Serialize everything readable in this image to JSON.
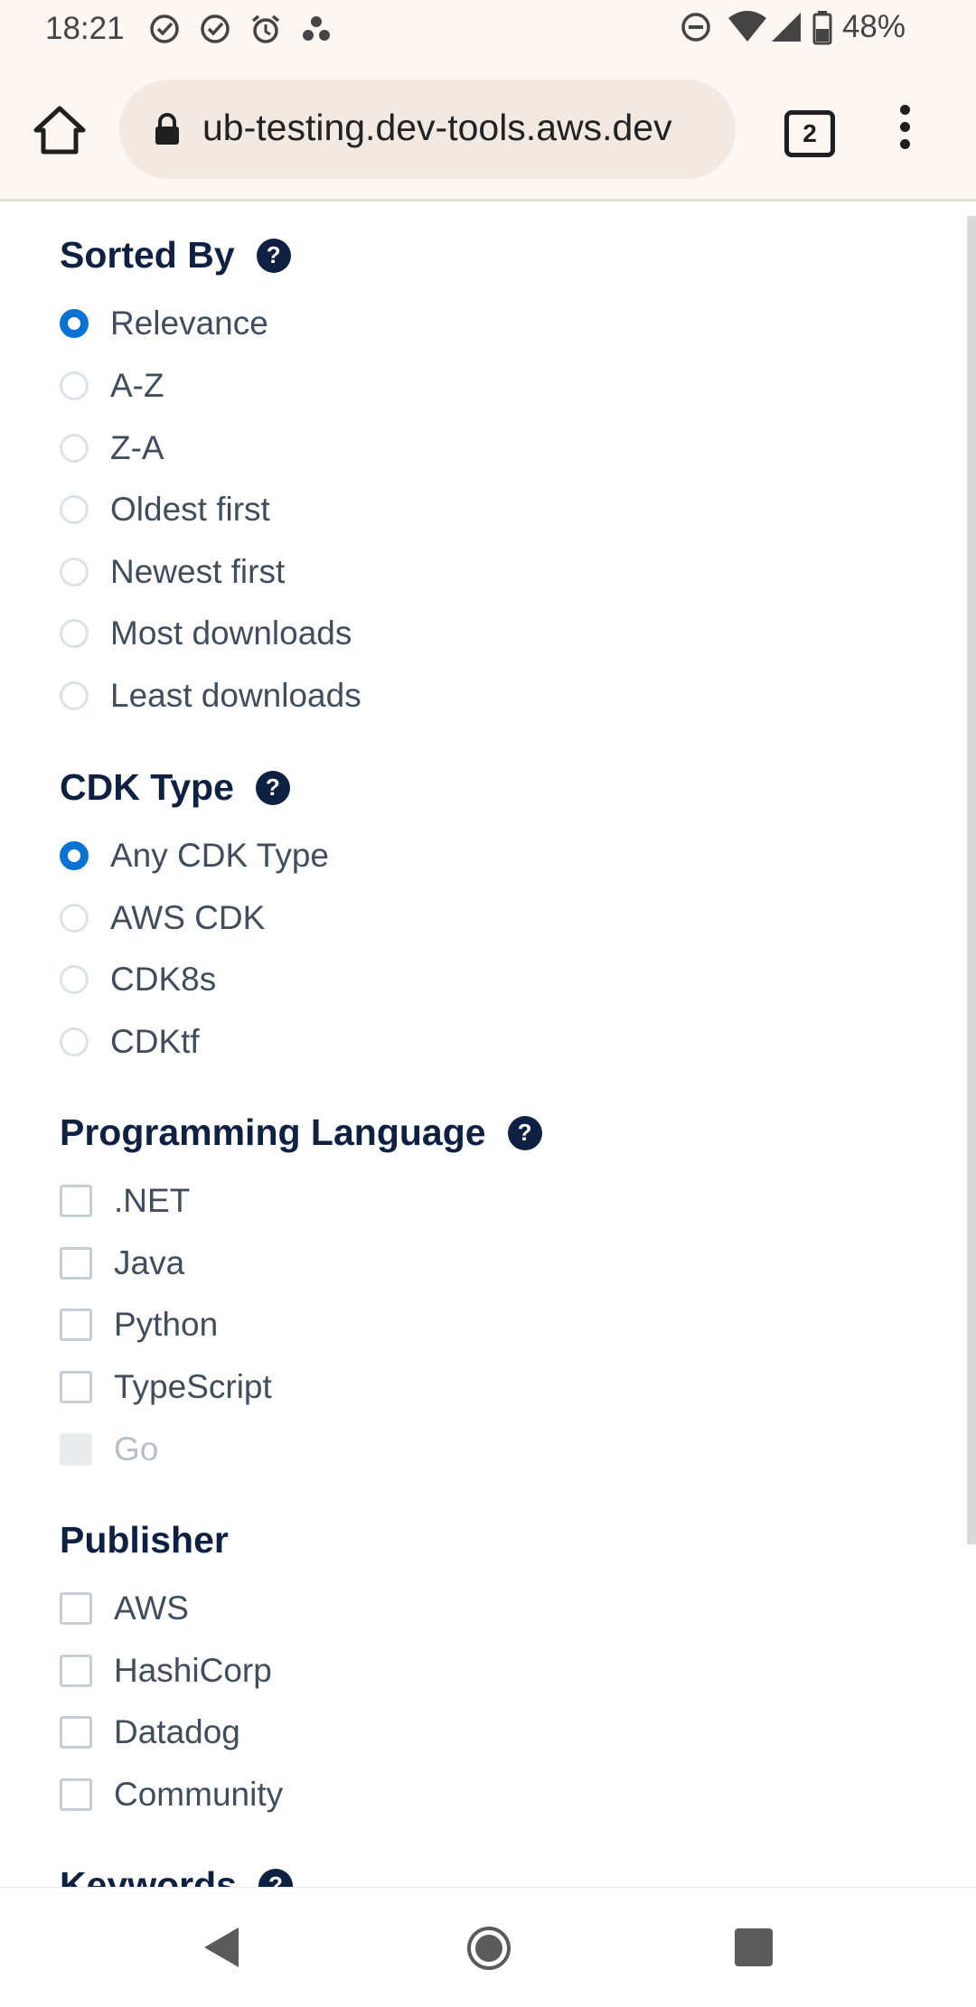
{
  "status_bar": {
    "time": "18:21",
    "battery_percent": "48%",
    "left_icons": [
      "check-circle-icon",
      "check-circle-icon",
      "alarm-icon",
      "assistant-icon"
    ],
    "right_icons": [
      "do-not-disturb-icon",
      "wifi-icon",
      "signal-icon",
      "battery-icon"
    ]
  },
  "browser": {
    "url": "ub-testing.dev-tools.aws.dev",
    "tab_count": "2"
  },
  "sections": {
    "sorted_by": {
      "title": "Sorted By",
      "options": [
        "Relevance",
        "A-Z",
        "Z-A",
        "Oldest first",
        "Newest first",
        "Most downloads",
        "Least downloads"
      ],
      "selected": "Relevance"
    },
    "cdk_type": {
      "title": "CDK Type",
      "options": [
        "Any CDK Type",
        "AWS CDK",
        "CDK8s",
        "CDKtf"
      ],
      "selected": "Any CDK Type"
    },
    "programming_language": {
      "title": "Programming Language",
      "options": [
        ".NET",
        "Java",
        "Python",
        "TypeScript",
        "Go"
      ],
      "disabled": [
        "Go"
      ]
    },
    "publisher": {
      "title": "Publisher",
      "options": [
        "AWS",
        "HashiCorp",
        "Datadog",
        "Community"
      ]
    },
    "keywords": {
      "title": "Keywords"
    }
  },
  "colors": {
    "heading": "#0f2143",
    "accent": "#0972d3",
    "label": "#414d5c",
    "disabled": "#b6bec9",
    "chrome_bg": "#fdf7f3"
  }
}
